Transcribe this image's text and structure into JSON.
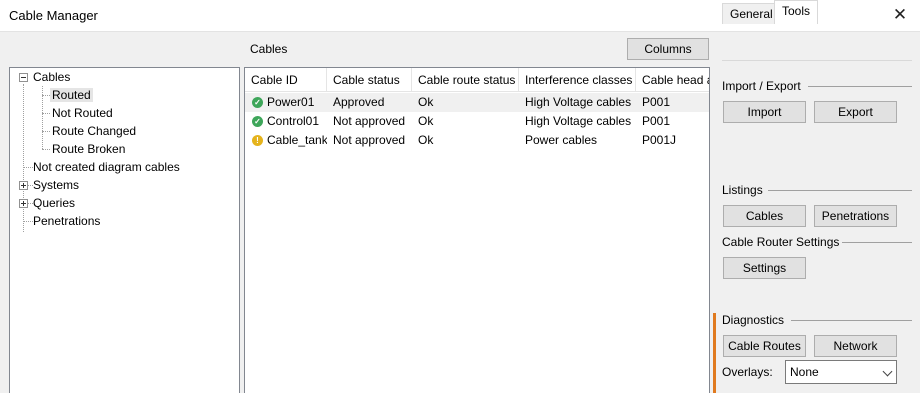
{
  "window": {
    "title": "Cable Manager",
    "close_glyph": "✕"
  },
  "center": {
    "title": "Cables",
    "columns_button": "Columns"
  },
  "tree": {
    "root": "Cables",
    "children": [
      "Routed",
      "Not Routed",
      "Route Changed",
      "Route Broken"
    ],
    "items": [
      "Not created diagram cables",
      "Systems",
      "Queries",
      "Penetrations"
    ]
  },
  "table": {
    "headers": [
      "Cable ID",
      "Cable status",
      "Cable route status",
      "Interference classes",
      "Cable head a"
    ],
    "rows": [
      {
        "icon": "check-circle-icon",
        "cable_id": "Power01",
        "status": "Approved",
        "route_status": "Ok",
        "interference": "High Voltage cables",
        "head": "P001"
      },
      {
        "icon": "check-circle-icon",
        "cable_id": "Control01",
        "status": "Not approved",
        "route_status": "Ok",
        "interference": "High Voltage cables",
        "head": "P001"
      },
      {
        "icon": "warning-circle-icon",
        "cable_id": "Cable_tank",
        "status": "Not approved",
        "route_status": "Ok",
        "interference": "Power cables",
        "head": "P001J"
      }
    ]
  },
  "tabs": {
    "general": "General",
    "tools": "Tools"
  },
  "tools": {
    "import_export": {
      "title": "Import / Export",
      "import": "Import",
      "export": "Export"
    },
    "listings": {
      "title": "Listings",
      "cables": "Cables",
      "penetrations": "Penetrations"
    },
    "router": {
      "title": "Cable Router Settings",
      "settings": "Settings"
    },
    "diagnostics": {
      "title": "Diagnostics",
      "cable_routes": "Cable Routes",
      "network": "Network",
      "overlays_label": "Overlays:",
      "overlays_value": "None"
    }
  },
  "colors": {
    "accent": "#e07a1f",
    "ok_icon": "#3ea65a",
    "warn_icon": "#e5b31c"
  }
}
